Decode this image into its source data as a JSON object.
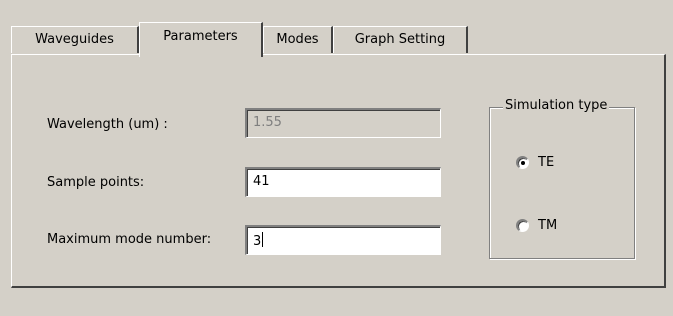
{
  "tabs": [
    {
      "label": "Waveguides",
      "active": false
    },
    {
      "label": "Parameters",
      "active": true
    },
    {
      "label": "Modes",
      "active": false
    },
    {
      "label": "Graph Setting",
      "active": false
    }
  ],
  "parameters": {
    "wavelength": {
      "label": "Wavelength (um) :",
      "value": "1.55",
      "enabled": false
    },
    "sample_points": {
      "label": "Sample points:",
      "value": "41",
      "enabled": true
    },
    "max_mode": {
      "label": "Maximum mode number:",
      "value": "3",
      "enabled": true,
      "focused": true
    }
  },
  "simulation_type": {
    "title": "Simulation type",
    "options": [
      {
        "label": "TE",
        "selected": true
      },
      {
        "label": "TM",
        "selected": false
      }
    ]
  }
}
